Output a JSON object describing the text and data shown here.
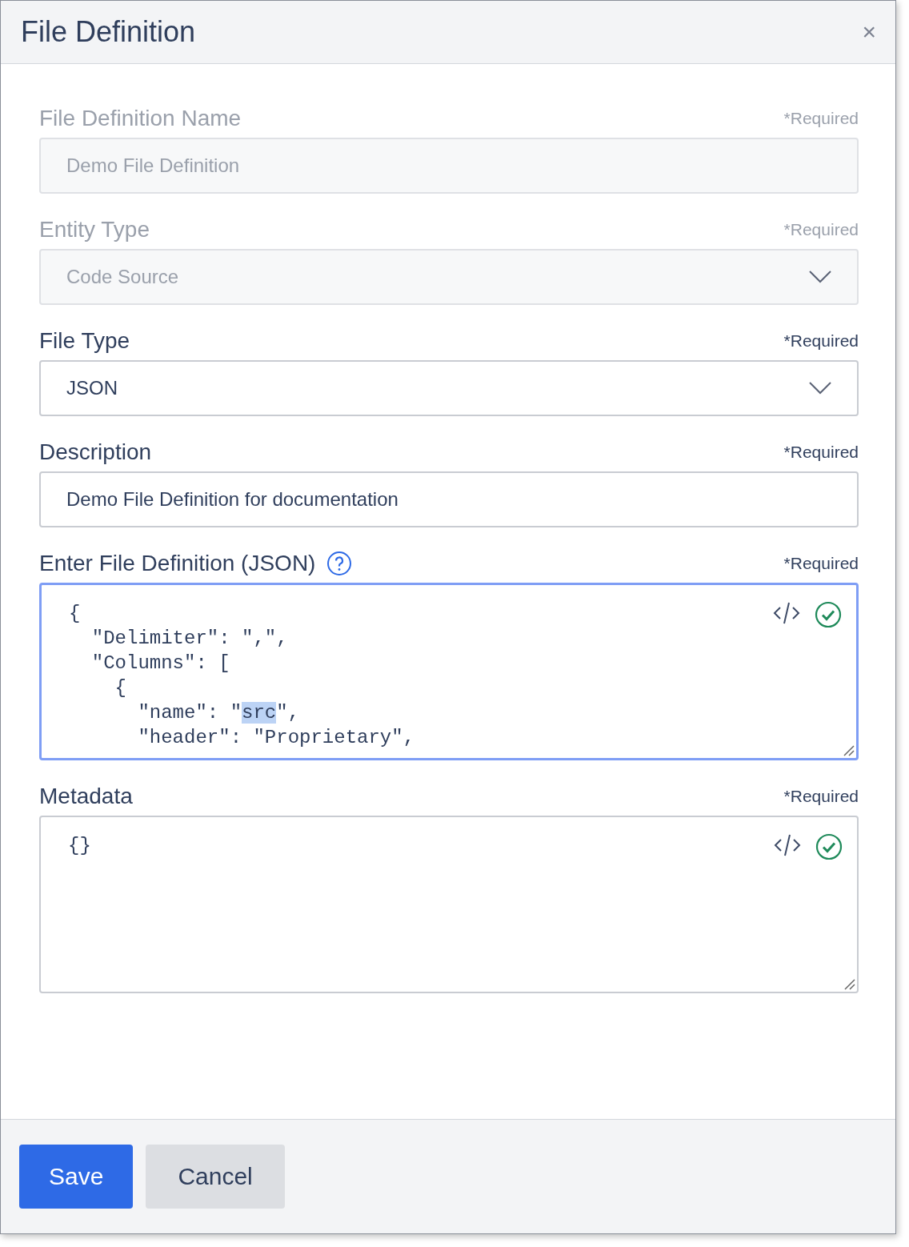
{
  "dialog": {
    "title": "File Definition",
    "close": "×"
  },
  "fields": [
    {
      "kind": "text",
      "label": "File Definition Name",
      "required": "*Required",
      "value": "Demo File Definition",
      "disabled": true
    },
    {
      "kind": "select",
      "label": "Entity Type",
      "required": "*Required",
      "value": "Code Source",
      "disabled": true
    },
    {
      "kind": "select",
      "label": "File Type",
      "required": "*Required",
      "value": "JSON",
      "disabled": false
    },
    {
      "kind": "text",
      "label": "Description",
      "required": "*Required",
      "value": "Demo File Definition for documentation",
      "disabled": false
    },
    {
      "kind": "code",
      "label": "Enter File Definition (JSON)",
      "help": true,
      "required": "*Required",
      "focused": true,
      "valid": true,
      "lines": [
        [
          {
            "text": "{",
            "selected": false
          }
        ],
        [
          {
            "text": "  \"Delimiter\": \",\",",
            "selected": false
          }
        ],
        [
          {
            "text": "  \"Columns\": [",
            "selected": false
          }
        ],
        [
          {
            "text": "    {",
            "selected": false
          }
        ],
        [
          {
            "text": "      \"name\": \"",
            "selected": false
          },
          {
            "text": "src",
            "selected": true
          },
          {
            "text": "\",",
            "selected": false
          }
        ],
        [
          {
            "text": "      \"header\": \"Proprietary\",",
            "selected": false
          }
        ]
      ]
    },
    {
      "kind": "code",
      "label": "Metadata",
      "required": "*Required",
      "focused": false,
      "valid": true,
      "lines": [
        [
          {
            "text": "{}",
            "selected": false
          }
        ]
      ]
    }
  ],
  "buttons": [
    {
      "label": "Save",
      "kind": "primary"
    },
    {
      "label": "Cancel",
      "kind": "secondary"
    }
  ]
}
